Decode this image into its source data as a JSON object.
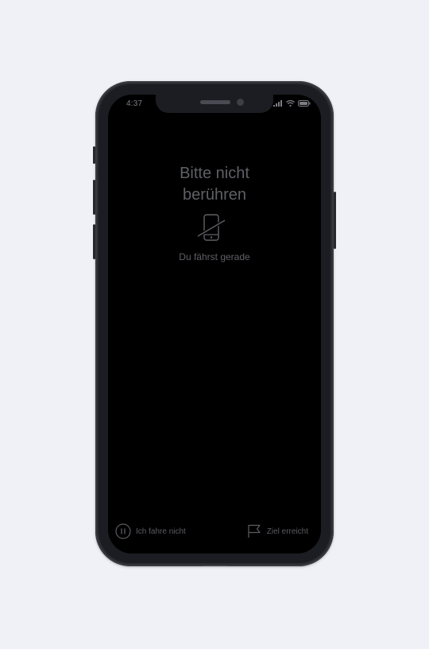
{
  "status_bar": {
    "time": "4:37",
    "signal_icon": "cellular-signal-icon",
    "wifi_icon": "wifi-icon",
    "battery_icon": "battery-icon"
  },
  "main": {
    "title_line1": "Bitte nicht",
    "title_line2": "berühren",
    "icon": "phone-crossed-out-icon",
    "subtitle": "Du fährst gerade"
  },
  "actions": {
    "not_driving_label": "Ich fahre nicht",
    "not_driving_icon": "pause-circle-icon",
    "arrived_label": "Ziel erreicht",
    "arrived_icon": "flag-icon"
  },
  "colors": {
    "background": "#eff1f6",
    "phone_frame": "#2a2b31",
    "screen": "#000000",
    "text_dim": "#5f6066"
  }
}
